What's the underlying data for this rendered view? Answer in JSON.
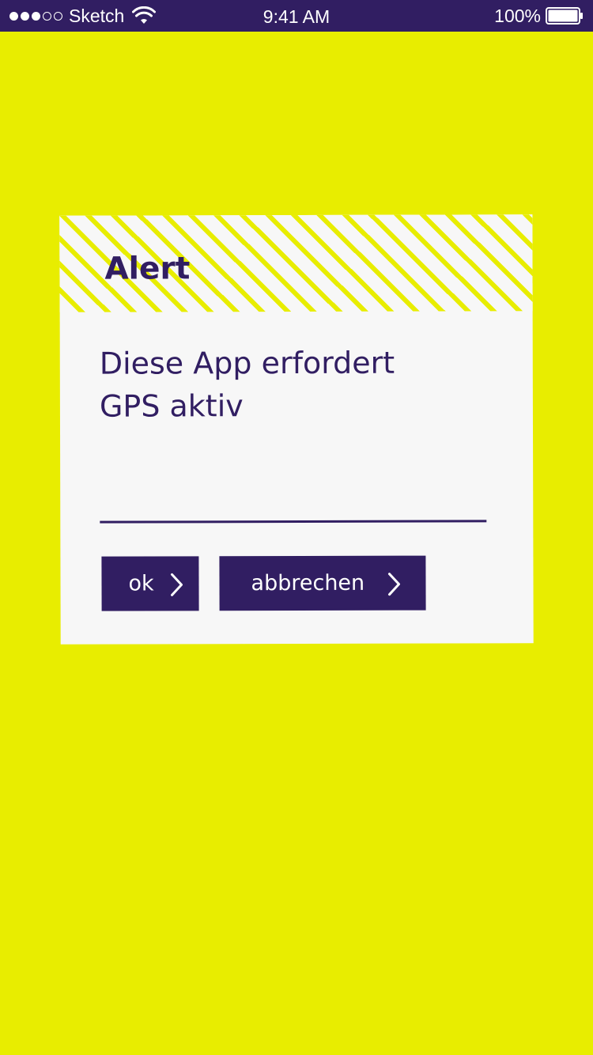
{
  "status_bar": {
    "carrier": "Sketch",
    "time": "9:41 AM",
    "battery": "100%",
    "signal_bars_filled": 3,
    "signal_bars_total": 5
  },
  "dialog": {
    "title": "Alert",
    "message_line1": "Diese App erfordert",
    "message_line2": "GPS aktiv",
    "ok_label": "ok",
    "cancel_label": "abbrechen"
  },
  "colors": {
    "background": "#e8ed00",
    "accent": "#311e62",
    "dialog_background": "#f7f7f7"
  },
  "icons": {
    "wifi": "wifi-icon",
    "battery": "battery-icon",
    "button_arrow": "chevron-right-icon"
  }
}
